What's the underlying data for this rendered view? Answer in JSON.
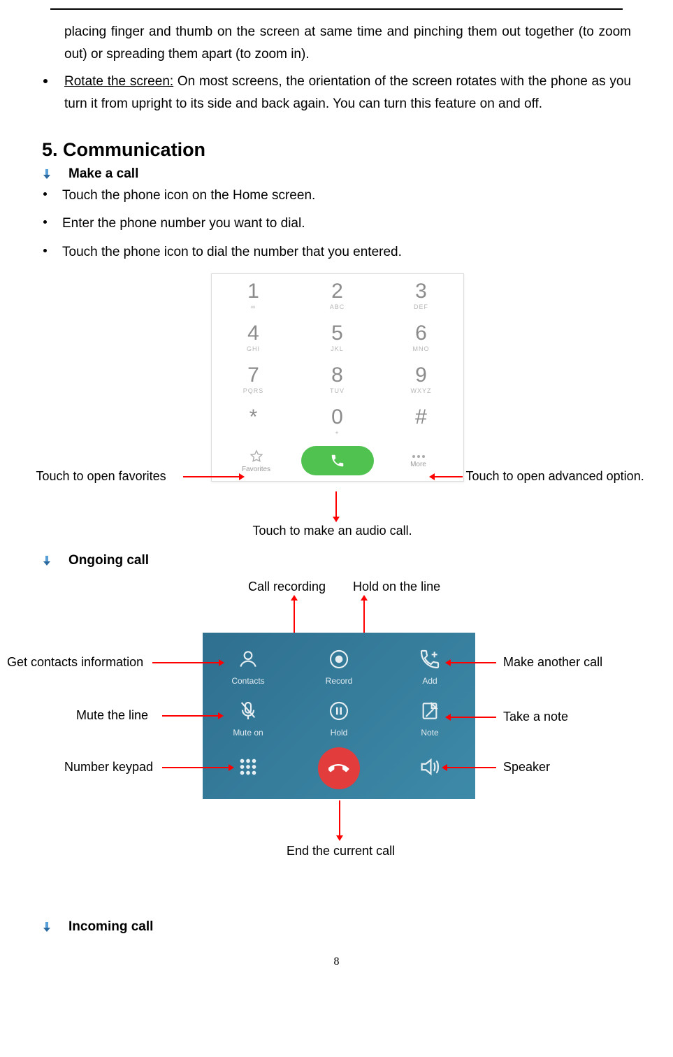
{
  "intro_continuation": "placing finger and thumb on the screen at same time and pinching them out together (to zoom out) or spreading them apart (to zoom in).",
  "rotate_label": "Rotate the screen:",
  "rotate_text": " On most screens, the orientation of the screen rotates with the phone as you turn it from upright to its side and back again. You can turn this feature on and off.",
  "section_num": "5.",
  "section_title": "Communication",
  "make_call_title": "Make a call",
  "make_call_bullets": [
    "Touch the phone icon on the Home screen.",
    "Enter the phone number you want to dial.",
    "Touch the phone icon to dial the number that you entered."
  ],
  "dialer": {
    "keys": [
      {
        "num": "1",
        "sub": "∞"
      },
      {
        "num": "2",
        "sub": "ABC"
      },
      {
        "num": "3",
        "sub": "DEF"
      },
      {
        "num": "4",
        "sub": "GHI"
      },
      {
        "num": "5",
        "sub": "JKL"
      },
      {
        "num": "6",
        "sub": "MNO"
      },
      {
        "num": "7",
        "sub": "PQRS"
      },
      {
        "num": "8",
        "sub": "TUV"
      },
      {
        "num": "9",
        "sub": "WXYZ"
      },
      {
        "num": "*",
        "sub": ""
      },
      {
        "num": "0",
        "sub": "+"
      },
      {
        "num": "#",
        "sub": ""
      }
    ],
    "favorites": "Favorites",
    "more": "More"
  },
  "dialer_annotations": {
    "favorites": "Touch to open favorites",
    "more": "Touch to open advanced option.",
    "call": "Touch to make an audio call."
  },
  "ongoing_title": "Ongoing call",
  "ongoing": {
    "row1": [
      "Contacts",
      "Record",
      "Add"
    ],
    "row2": [
      "Mute on",
      "Hold",
      "Note"
    ]
  },
  "ongoing_annotations": {
    "contacts": "Get contacts information",
    "record": "Call recording",
    "add": "Make another call",
    "mute": "Mute the line",
    "hold": "Hold on the line",
    "note": "Take a note",
    "keypad": "Number keypad",
    "speaker": "Speaker",
    "end": "End the current call"
  },
  "incoming_title": "Incoming call",
  "page_number": "8"
}
